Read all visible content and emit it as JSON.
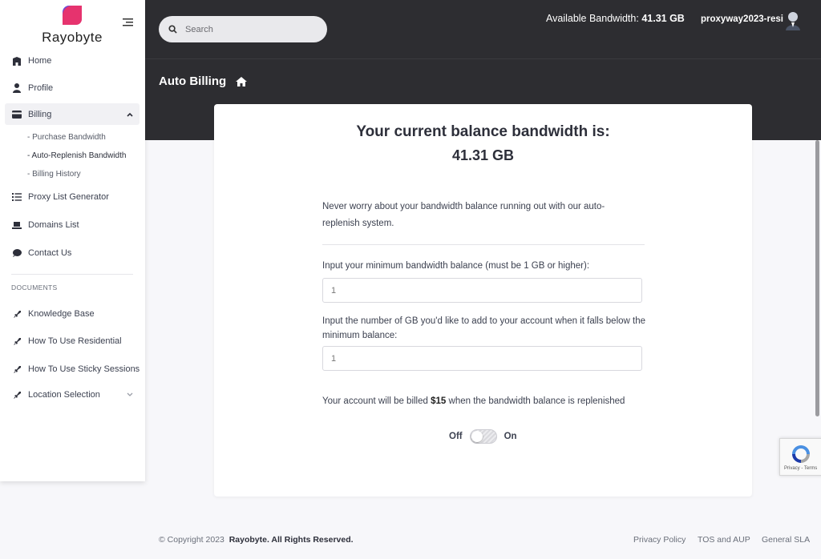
{
  "brand": {
    "name": "Rayobyte",
    "accent": "#e6336e"
  },
  "header": {
    "search_placeholder": "Search",
    "bandwidth_label": "Available Bandwidth:",
    "bandwidth_value": "41.31 GB",
    "username": "proxyway2023-resi"
  },
  "page": {
    "title": "Auto Billing"
  },
  "sidebar": {
    "items": [
      {
        "label": "Home",
        "icon": "home-icon"
      },
      {
        "label": "Profile",
        "icon": "user-icon"
      },
      {
        "label": "Billing",
        "icon": "credit-card-icon",
        "expanded": true
      },
      {
        "label": "Proxy List Generator",
        "icon": "list-icon"
      },
      {
        "label": "Domains List",
        "icon": "laptop-icon"
      },
      {
        "label": "Contact Us",
        "icon": "chat-icon"
      }
    ],
    "billing_sub": [
      "- Purchase Bandwidth",
      "- Auto-Replenish Bandwidth",
      "- Billing History"
    ],
    "documents_heading": "DOCUMENTS",
    "documents": [
      {
        "label": "Knowledge Base",
        "icon": "rocket-icon"
      },
      {
        "label": "How To Use Residential",
        "icon": "rocket-icon"
      },
      {
        "label": "How To Use Sticky Sessions",
        "icon": "rocket-icon"
      },
      {
        "label": "Location Selection",
        "icon": "rocket-icon"
      }
    ]
  },
  "card": {
    "balance_title": "Your current balance bandwidth is:",
    "balance_value": "41.31 GB",
    "intro": "Never worry about your bandwidth balance running out with our auto-replenish system.",
    "min_label": "Input your minimum bandwidth balance (must be 1 GB or higher):",
    "min_value": "1",
    "add_label": "Input the number of GB you'd like to add to your account when it falls below the minimum balance:",
    "add_value": "1",
    "billed_prefix": "Your account will be billed",
    "billed_amount": "$15",
    "billed_suffix": "when the bandwidth balance is replenished",
    "toggle_off": "Off",
    "toggle_on": "On",
    "toggle_state": "off"
  },
  "recaptcha": {
    "text": "Privacy - Terms"
  },
  "footer": {
    "copyright": "© Copyright 2023",
    "company": "Rayobyte. All Rights Reserved.",
    "links": [
      "Privacy Policy",
      "TOS and AUP",
      "General SLA"
    ]
  }
}
